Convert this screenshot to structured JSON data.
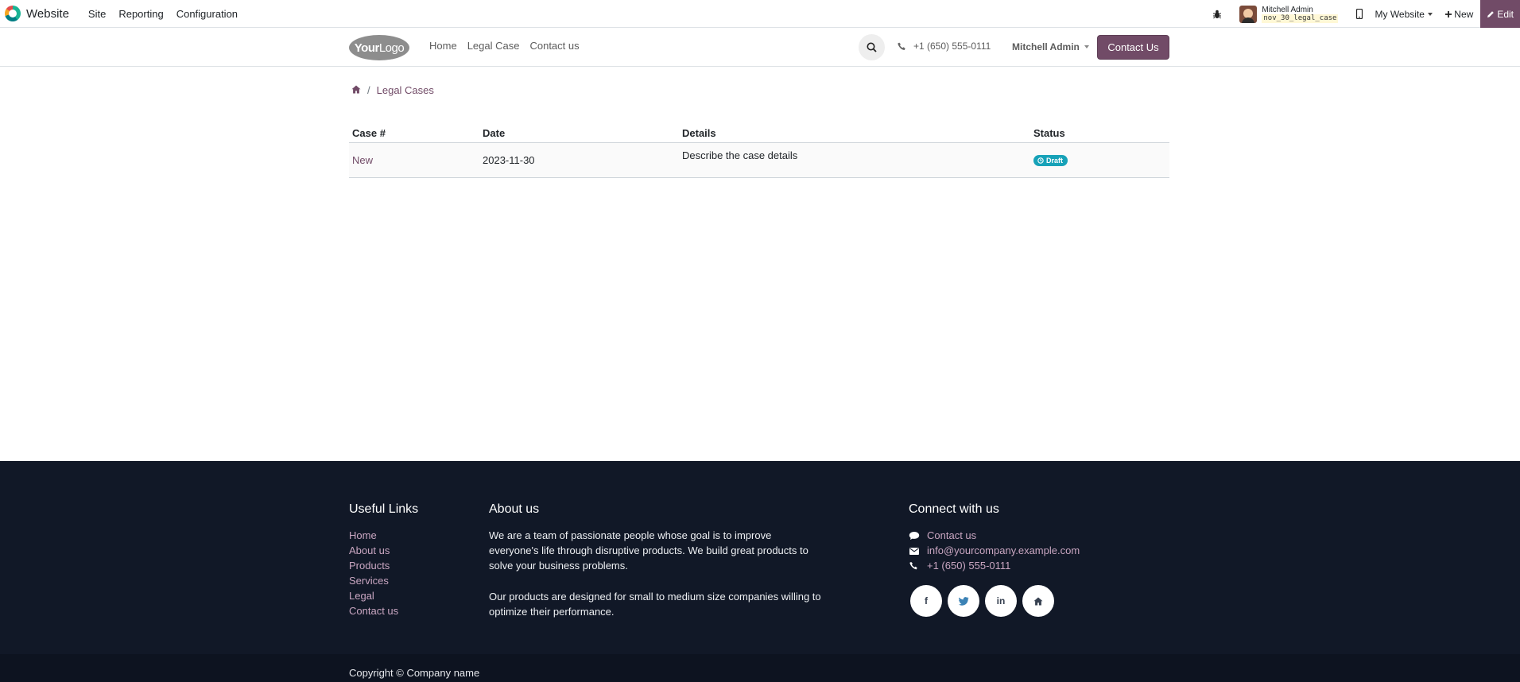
{
  "adminbar": {
    "app_name": "Website",
    "menu": [
      "Site",
      "Reporting",
      "Configuration"
    ],
    "user_name": "Mitchell Admin",
    "db_name": "nov_30_legal_case",
    "website_selector": "My Website",
    "new_label": "New",
    "edit_label": "Edit"
  },
  "header": {
    "logo_bold": "Your",
    "logo_light": "Logo",
    "nav": [
      "Home",
      "Legal Case",
      "Contact us"
    ],
    "phone": "+1 (650) 555-0111",
    "user_menu": "Mitchell Admin",
    "contact_button": "Contact Us"
  },
  "breadcrumb": {
    "separator": "/",
    "current": "Legal Cases"
  },
  "table": {
    "headers": [
      "Case #",
      "Date",
      "Details",
      "Status"
    ],
    "rows": [
      {
        "case": "New",
        "date": "2023-11-30",
        "details": "Describe the case details",
        "status": "Draft"
      }
    ]
  },
  "footer": {
    "useful_links_title": "Useful Links",
    "useful_links": [
      "Home",
      "About us",
      "Products",
      "Services",
      "Legal",
      "Contact us"
    ],
    "about_title": "About us",
    "about_p1": "We are a team of passionate people whose goal is to improve everyone's life through disruptive products. We build great products to solve your business problems.",
    "about_p2": "Our products are designed for small to medium size companies willing to optimize their performance.",
    "connect_title": "Connect with us",
    "connect_contact": "Contact us",
    "connect_email": "info@yourcompany.example.com",
    "connect_phone": "+1 (650) 555-0111",
    "social_icons": [
      "facebook-icon",
      "twitter-icon",
      "linkedin-icon",
      "home-icon"
    ],
    "linkedin_text": "in",
    "facebook_text": "f",
    "copyright": "Copyright © Company name"
  },
  "colors": {
    "brand": "#714b67",
    "badge": "#17a2b8",
    "footer_bg": "#111827"
  }
}
